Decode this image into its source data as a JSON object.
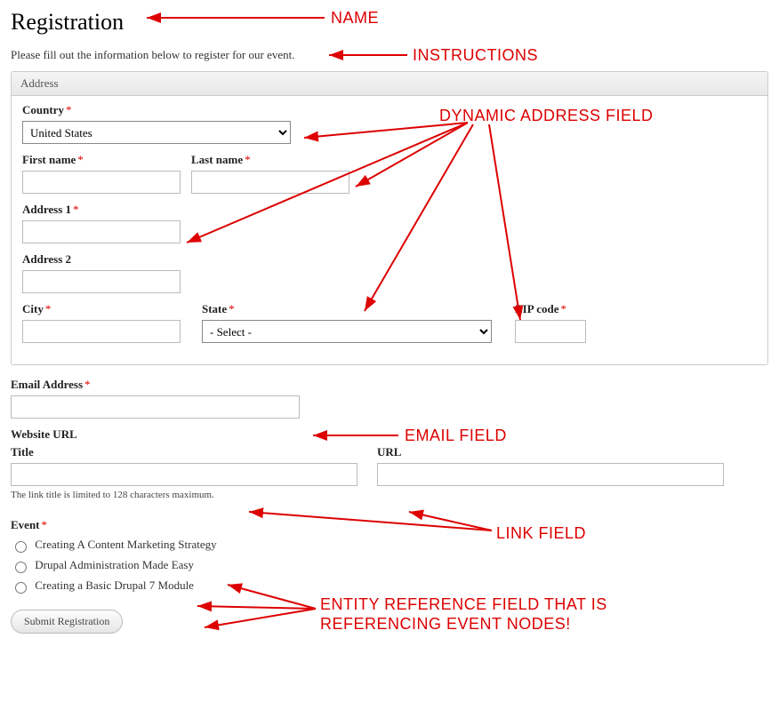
{
  "page": {
    "title": "Registration",
    "instructions": "Please fill out the information below to register for our event."
  },
  "address": {
    "legend": "Address",
    "country": {
      "label": "Country",
      "value": "United States",
      "required": true
    },
    "first_name": {
      "label": "First name",
      "value": "",
      "required": true
    },
    "last_name": {
      "label": "Last name",
      "value": "",
      "required": true
    },
    "address1": {
      "label": "Address 1",
      "value": "",
      "required": true
    },
    "address2": {
      "label": "Address 2",
      "value": "",
      "required": false
    },
    "city": {
      "label": "City",
      "value": "",
      "required": true
    },
    "state": {
      "label": "State",
      "value": "- Select -",
      "required": true
    },
    "zip": {
      "label": "ZIP code",
      "value": "",
      "required": true
    }
  },
  "email": {
    "label": "Email Address",
    "value": "",
    "required": true
  },
  "website": {
    "group_label": "Website URL",
    "title": {
      "label": "Title",
      "value": ""
    },
    "url": {
      "label": "URL",
      "value": ""
    },
    "hint": "The link title is limited to 128 characters maximum."
  },
  "event": {
    "label": "Event",
    "required": true,
    "options": [
      "Creating A Content Marketing Strategy",
      "Drupal Administration Made Easy",
      "Creating a Basic Drupal 7 Module"
    ]
  },
  "submit_label": "Submit Registration",
  "annotations": {
    "name": "NAME",
    "instructions": "INSTRUCTIONS",
    "dynamic_address": "DYNAMIC ADDRESS FIELD",
    "email": "EMAIL FIELD",
    "link": "LINK FIELD",
    "entity_ref_l1": "ENTITY REFERENCE FIELD THAT IS",
    "entity_ref_l2": "REFERENCING EVENT NODES!"
  },
  "asterisk": "*"
}
